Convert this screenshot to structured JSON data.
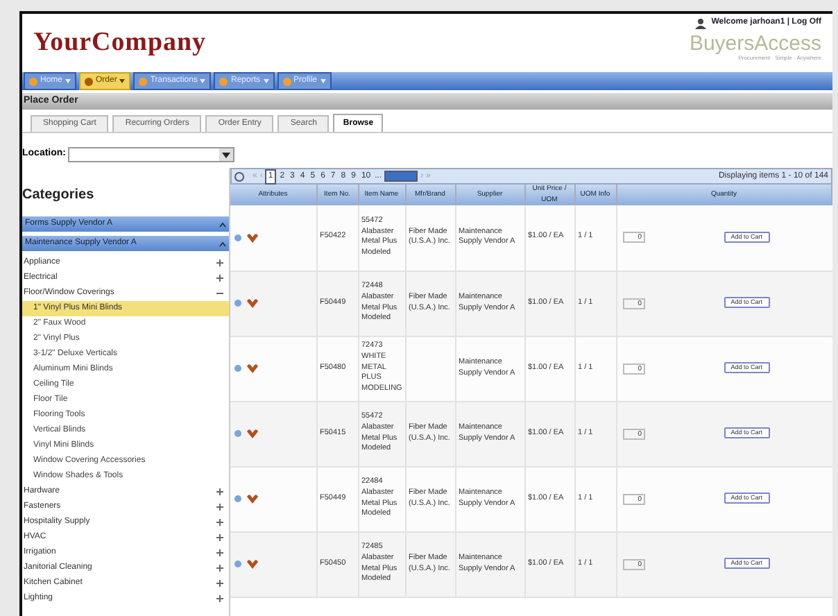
{
  "header": {
    "logo": "YourCompany",
    "welcome": "Welcome jarhoan1 | Log Off",
    "brand": "BuyersAccess",
    "tagline": "Procurement · Simple · Anywhere"
  },
  "nav": [
    {
      "label": "Home",
      "selected": false
    },
    {
      "label": "Order",
      "selected": true
    },
    {
      "label": "Transactions",
      "selected": false
    },
    {
      "label": "Reports",
      "selected": false
    },
    {
      "label": "Profile",
      "selected": false
    }
  ],
  "page_title": "Place Order",
  "subtabs": [
    {
      "label": "Shopping Cart",
      "selected": false
    },
    {
      "label": "Recurring Orders",
      "selected": false
    },
    {
      "label": "Order Entry",
      "selected": false
    },
    {
      "label": "Search",
      "selected": false
    },
    {
      "label": "Browse",
      "selected": true
    }
  ],
  "location": {
    "label": "Location:"
  },
  "sidebar": {
    "title": "Categories",
    "vendors": [
      {
        "label": "Forms Supply Vendor A"
      },
      {
        "label": "Maintenance Supply Vendor A"
      }
    ],
    "items": [
      {
        "label": "Appliance",
        "expanded": false
      },
      {
        "label": "Electrical",
        "expanded": false
      },
      {
        "label": "Floor/Window Coverings",
        "expanded": true,
        "children": [
          {
            "label": "1\" Vinyl Plus Mini Blinds",
            "selected": true
          },
          {
            "label": "2\" Faux Wood",
            "selected": false
          },
          {
            "label": "2\" Vinyl Plus",
            "selected": false
          },
          {
            "label": "3-1/2\" Deluxe Verticals",
            "selected": false
          },
          {
            "label": "Aluminum Mini Blinds",
            "selected": false
          },
          {
            "label": "Ceiling Tile",
            "selected": false
          },
          {
            "label": "Floor Tile",
            "selected": false
          },
          {
            "label": "Flooring Tools",
            "selected": false
          },
          {
            "label": "Vertical Blinds",
            "selected": false
          },
          {
            "label": "Vinyl Mini Blinds",
            "selected": false
          },
          {
            "label": "Window Covering Accessories",
            "selected": false
          },
          {
            "label": "Window Shades & Tools",
            "selected": false
          }
        ]
      },
      {
        "label": "Hardware",
        "expanded": false
      },
      {
        "label": "Fasteners",
        "expanded": false
      },
      {
        "label": "Hospitality Supply",
        "expanded": false
      },
      {
        "label": "HVAC",
        "expanded": false
      },
      {
        "label": "Irrigation",
        "expanded": false
      },
      {
        "label": "Janitorial Cleaning",
        "expanded": false
      },
      {
        "label": "Kitchen Cabinet",
        "expanded": false
      },
      {
        "label": "Lighting",
        "expanded": false
      }
    ]
  },
  "pager": {
    "first": "«",
    "prev": "‹",
    "pages": [
      {
        "label": "1",
        "selected": true
      },
      {
        "label": "2",
        "selected": false
      },
      {
        "label": "3",
        "selected": false
      },
      {
        "label": "4",
        "selected": false
      },
      {
        "label": "5",
        "selected": false
      },
      {
        "label": "6",
        "selected": false
      },
      {
        "label": "7",
        "selected": false
      },
      {
        "label": "8",
        "selected": false
      },
      {
        "label": "9",
        "selected": false
      },
      {
        "label": "10",
        "selected": false
      }
    ],
    "more": "...",
    "next": "›",
    "last": "»",
    "summary": "Displaying items 1 - 10 of 144"
  },
  "table": {
    "columns": [
      "Attributes",
      "Item No.",
      "Item Name",
      "Mfr/Brand",
      "Supplier",
      "Unit Price / UOM",
      "UOM Info",
      "Quantity"
    ],
    "rows": [
      {
        "item_no": "F50422",
        "name": "55472 Alabaster Metal Plus Modeled",
        "mfr": "Fiber Made (U.S.A.) Inc.",
        "supplier": "Maintenance Supply Vendor A",
        "price": "$1.00 / EA",
        "uom": "1 / 1",
        "qty": "0",
        "button": "Add to Cart"
      },
      {
        "item_no": "F50449",
        "name": "72448 Alabaster Metal Plus Modeled",
        "mfr": "Fiber Made (U.S.A.) Inc.",
        "supplier": "Maintenance Supply Vendor A",
        "price": "$1.00 / EA",
        "uom": "1 / 1",
        "qty": "0",
        "button": "Add to Cart"
      },
      {
        "item_no": "F50480",
        "name": "72473 WHITE METAL PLUS MODELING",
        "supplier": "Maintenance Supply Vendor A",
        "price": "$1.00 / EA",
        "uom": "1 / 1",
        "qty": "0",
        "button": "Add to Cart"
      },
      {
        "item_no": "F50415",
        "name": "55472 Alabaster Metal Plus Modeled",
        "mfr": "Fiber Made (U.S.A.) Inc.",
        "supplier": "Maintenance Supply Vendor A",
        "price": "$1.00 / EA",
        "uom": "1 / 1",
        "qty": "0",
        "button": "Add to Cart"
      },
      {
        "item_no": "F50449",
        "name": "22484 Alabaster Metal Plus Modeled",
        "mfr": "Fiber Made (U.S.A.) Inc.",
        "supplier": "Maintenance Supply Vendor A",
        "price": "$1.00 / EA",
        "uom": "1 / 1",
        "qty": "0",
        "button": "Add to Cart"
      },
      {
        "item_no": "F50450",
        "name": "72485 Alabaster Metal Plus Modeled",
        "mfr": "Fiber Made (U.S.A.) Inc.",
        "supplier": "Maintenance Supply Vendor A",
        "price": "$1.00 / EA",
        "uom": "1 / 1",
        "qty": "0",
        "button": "Add to Cart"
      }
    ]
  }
}
